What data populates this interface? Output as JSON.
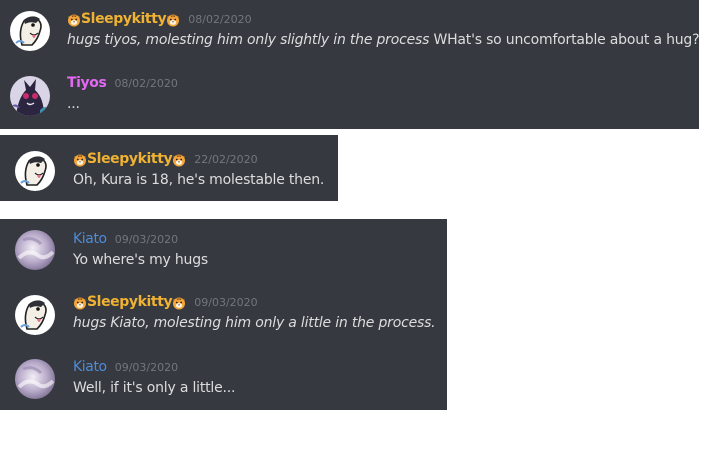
{
  "panels": [
    {
      "messages": [
        {
          "author": "Sleepykitty",
          "timestamp": "08/02/2020",
          "italic": "hugs tiyos, molesting him only slightly in the process",
          "text": " WHat's so uncomfortable about a hug?"
        },
        {
          "author": "Tiyos",
          "timestamp": "08/02/2020",
          "italic": "",
          "text": "..."
        }
      ]
    },
    {
      "messages": [
        {
          "author": "Sleepykitty",
          "timestamp": "22/02/2020",
          "italic": "",
          "text": "Oh, Kura is 18, he's molestable then."
        }
      ]
    },
    {
      "messages": [
        {
          "author": "Kiato",
          "timestamp": "09/03/2020",
          "italic": "",
          "text": "Yo where's my hugs"
        },
        {
          "author": "Sleepykitty",
          "timestamp": "09/03/2020",
          "italic": "hugs Kiato, molesting him only a little in the process.",
          "text": ""
        },
        {
          "author": "Kiato",
          "timestamp": "09/03/2020",
          "italic": "",
          "text": "Well, if it's only a little..."
        }
      ]
    }
  ],
  "colors": {
    "background": "#36393f",
    "sleepykitty": "#f0b232",
    "tiyos": "#e468f2",
    "kiato": "#4f8bd6",
    "message_text": "#dcddde",
    "timestamp": "#72767d"
  },
  "icons": {
    "name_decoration": "tiger-face-icon"
  }
}
